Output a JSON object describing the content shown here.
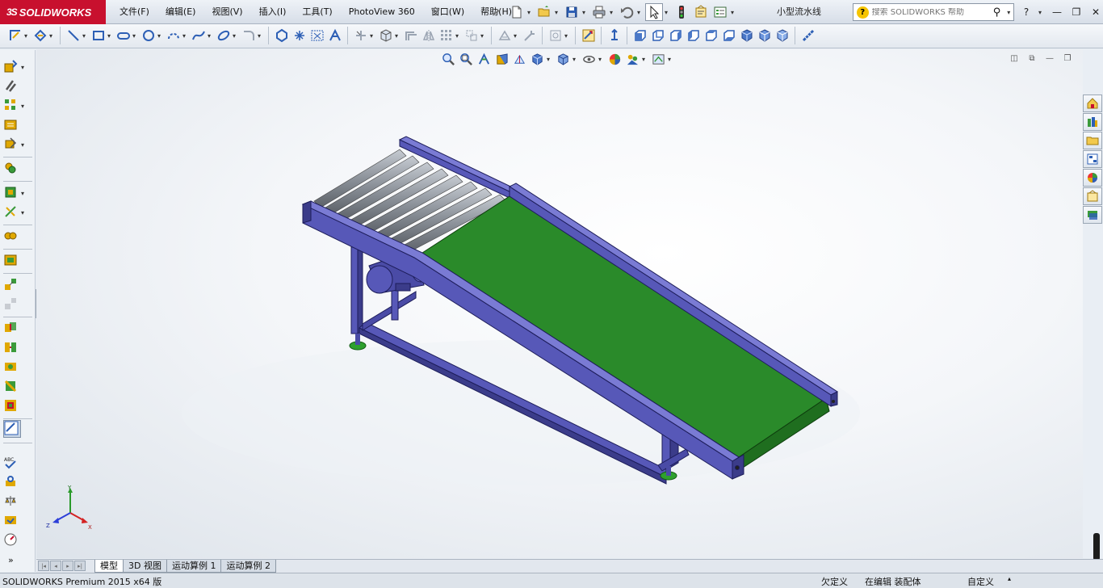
{
  "app": {
    "logo_text": "SOLIDWORKS",
    "logo_mark": "3S",
    "document_title": "小型流水线"
  },
  "menu": {
    "items": [
      "文件(F)",
      "编辑(E)",
      "视图(V)",
      "插入(I)",
      "工具(T)",
      "PhotoView 360",
      "窗口(W)",
      "帮助(H)"
    ]
  },
  "search": {
    "placeholder": "搜索 SOLIDWORKS 帮助"
  },
  "tabs": {
    "items": [
      "模型",
      "3D 视图",
      "运动算例 1",
      "运动算例 2"
    ],
    "active_index": 0
  },
  "triad": {
    "x_label": "X",
    "y_label": "Y",
    "z_label": "Z"
  },
  "status": {
    "product": "SOLIDWORKS Premium 2015 x64 版",
    "definition": "欠定义",
    "mode": "在编辑 装配体",
    "units": "自定义"
  },
  "colors": {
    "brand": "#c8102e",
    "frame": "#5758b8",
    "belt": "#2a8a2a",
    "roller": "#9aa0a8",
    "foot": "#2ea02e"
  },
  "icons": {
    "quick": [
      "pin-icon",
      "new-document-icon",
      "open-folder-icon",
      "save-icon",
      "print-icon",
      "undo-icon",
      "select-cursor-icon",
      "traffic-light-icon",
      "file-properties-icon",
      "options-icon"
    ],
    "heads_up": [
      "zoom-to-fit-icon",
      "zoom-to-area-icon",
      "previous-view-icon",
      "section-view-icon",
      "dynamic-annotation-icon",
      "view-orientation-icon",
      "display-style-icon",
      "hide-show-items-icon",
      "edit-appearance-icon",
      "apply-scene-icon",
      "view-settings-icon"
    ],
    "task_pane": [
      "solidworks-resources-icon",
      "design-library-icon",
      "file-explorer-icon",
      "view-palette-icon",
      "appearances-icon",
      "custom-properties-icon",
      "solidworks-forum-icon"
    ]
  }
}
